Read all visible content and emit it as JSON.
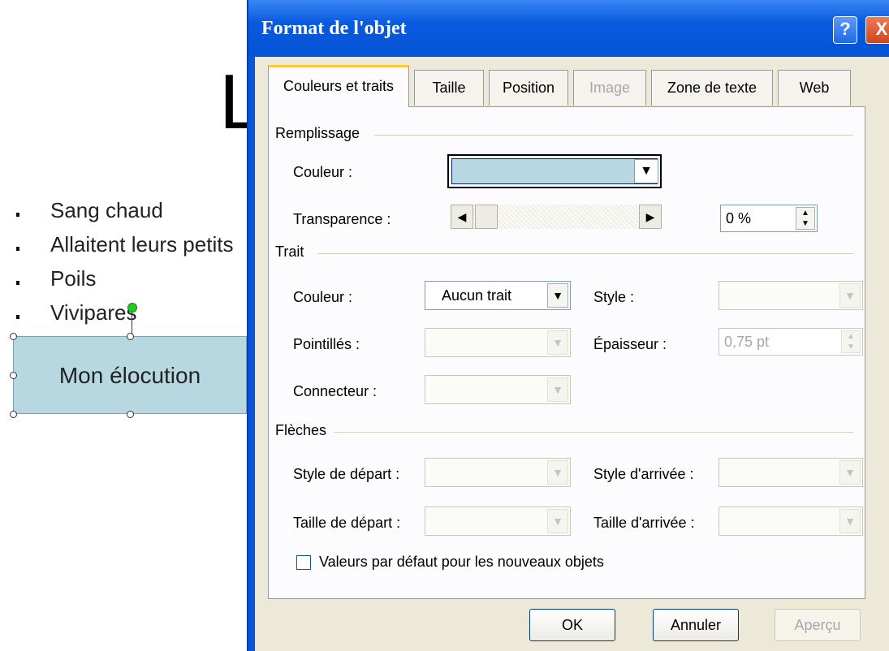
{
  "slide": {
    "title_fragment": "L",
    "bullets": [
      "Sang chaud",
      "Allaitent leurs petits",
      "Poils",
      "Vivipares"
    ],
    "selected_shape_text": "Mon élocution",
    "shape_fill_color": "#b7d8e0"
  },
  "dialog": {
    "title": "Format de l'objet",
    "help_icon": "?",
    "close_icon": "X",
    "tabs": [
      {
        "label": "Couleurs et traits",
        "state": "active"
      },
      {
        "label": "Taille",
        "state": "normal"
      },
      {
        "label": "Position",
        "state": "normal"
      },
      {
        "label": "Image",
        "state": "disabled"
      },
      {
        "label": "Zone de texte",
        "state": "normal"
      },
      {
        "label": "Web",
        "state": "normal"
      }
    ],
    "fill": {
      "section": "Remplissage",
      "color_label": "Couleur :",
      "color_value": "#b7d8e0",
      "transparency_label": "Transparence :",
      "transparency_value": "0 %"
    },
    "line": {
      "section": "Trait",
      "color_label": "Couleur :",
      "color_value": "Aucun trait",
      "style_label": "Style :",
      "dash_label": "Pointillés :",
      "weight_label": "Épaisseur :",
      "weight_value": "0,75 pt",
      "connector_label": "Connecteur :"
    },
    "arrows": {
      "section": "Flèches",
      "begin_style_label": "Style de départ :",
      "end_style_label": "Style d'arrivée :",
      "begin_size_label": "Taille de départ :",
      "end_size_label": "Taille d'arrivée :"
    },
    "default_checkbox_label": "Valeurs par défaut pour les nouveaux objets",
    "default_checkbox_checked": false,
    "buttons": {
      "ok": "OK",
      "cancel": "Annuler",
      "preview": "Aperçu"
    }
  }
}
